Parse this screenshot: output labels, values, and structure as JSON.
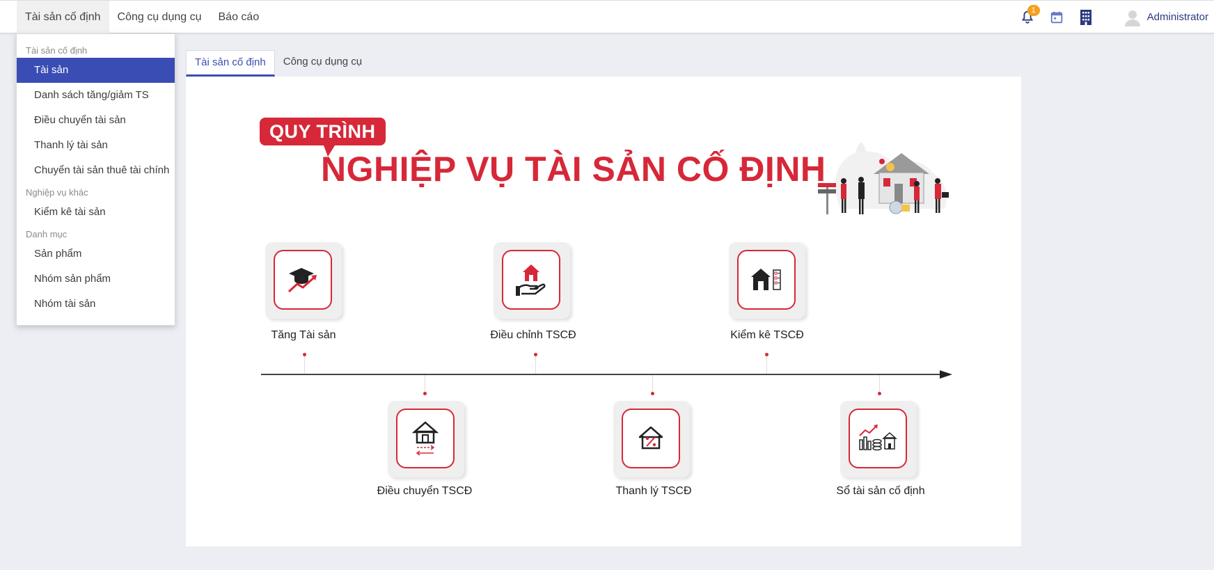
{
  "topnav": {
    "items": [
      {
        "label": "Tài sản cố định"
      },
      {
        "label": "Công cụ dụng cụ"
      },
      {
        "label": "Báo cáo"
      }
    ],
    "notification_count": "1",
    "user_name": "Administrator"
  },
  "menu": {
    "group_fixed_assets": "Tài sản cố định",
    "items_fixed_assets": [
      {
        "label": "Tài sản"
      },
      {
        "label": "Danh sách tăng/giảm TS"
      },
      {
        "label": "Điều chuyển tài sản"
      },
      {
        "label": "Thanh lý tài sản"
      },
      {
        "label": "Chuyển tài sản thuê tài chính"
      }
    ],
    "group_other": "Nghiệp vụ khác",
    "items_other": [
      {
        "label": "Kiểm kê tài sản"
      }
    ],
    "group_catalog": "Danh mục",
    "items_catalog": [
      {
        "label": "Sản phẩm"
      },
      {
        "label": "Nhóm sản phẩm"
      },
      {
        "label": "Nhóm tài sản"
      }
    ]
  },
  "tabs": [
    {
      "label": "Tài sản cố định"
    },
    {
      "label": "Công cụ dụng cụ"
    }
  ],
  "process": {
    "badge": "QUY TRÌNH",
    "title": "NGHIỆP VỤ TÀI SẢN CỐ ĐỊNH",
    "steps": [
      {
        "label": "Tăng Tài sản",
        "icon": "graduation-growth-icon"
      },
      {
        "label": "Điều chuyển TSCĐ",
        "icon": "house-transfer-icon"
      },
      {
        "label": "Điều chỉnh TSCĐ",
        "icon": "hand-house-icon"
      },
      {
        "label": "Thanh lý TSCĐ",
        "icon": "house-percent-icon"
      },
      {
        "label": "Kiểm kê TSCĐ",
        "icon": "house-checklist-icon"
      },
      {
        "label": "Sổ tài sản cố định",
        "icon": "ledger-chart-icon"
      }
    ]
  },
  "colors": {
    "accent": "#3a4db4",
    "brand_red": "#d62839",
    "badge_orange": "#f5a01f"
  }
}
